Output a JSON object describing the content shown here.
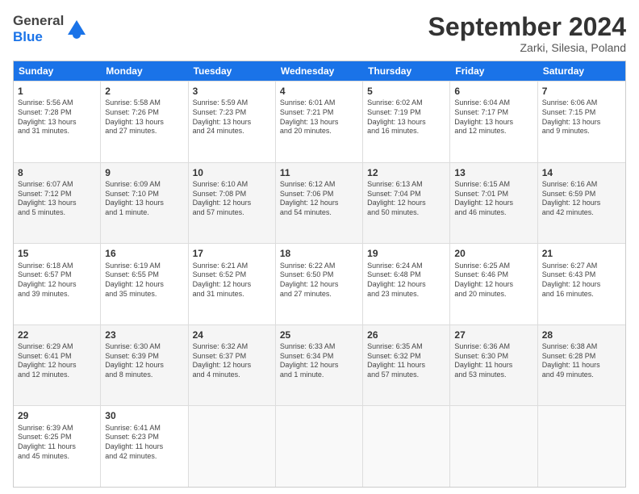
{
  "logo": {
    "line1": "General",
    "line2": "Blue"
  },
  "title": "September 2024",
  "location": "Zarki, Silesia, Poland",
  "weekdays": [
    "Sunday",
    "Monday",
    "Tuesday",
    "Wednesday",
    "Thursday",
    "Friday",
    "Saturday"
  ],
  "rows": [
    [
      {
        "day": "1",
        "info": "Sunrise: 5:56 AM\nSunset: 7:28 PM\nDaylight: 13 hours\nand 31 minutes."
      },
      {
        "day": "2",
        "info": "Sunrise: 5:58 AM\nSunset: 7:26 PM\nDaylight: 13 hours\nand 27 minutes."
      },
      {
        "day": "3",
        "info": "Sunrise: 5:59 AM\nSunset: 7:23 PM\nDaylight: 13 hours\nand 24 minutes."
      },
      {
        "day": "4",
        "info": "Sunrise: 6:01 AM\nSunset: 7:21 PM\nDaylight: 13 hours\nand 20 minutes."
      },
      {
        "day": "5",
        "info": "Sunrise: 6:02 AM\nSunset: 7:19 PM\nDaylight: 13 hours\nand 16 minutes."
      },
      {
        "day": "6",
        "info": "Sunrise: 6:04 AM\nSunset: 7:17 PM\nDaylight: 13 hours\nand 12 minutes."
      },
      {
        "day": "7",
        "info": "Sunrise: 6:06 AM\nSunset: 7:15 PM\nDaylight: 13 hours\nand 9 minutes."
      }
    ],
    [
      {
        "day": "8",
        "info": "Sunrise: 6:07 AM\nSunset: 7:12 PM\nDaylight: 13 hours\nand 5 minutes."
      },
      {
        "day": "9",
        "info": "Sunrise: 6:09 AM\nSunset: 7:10 PM\nDaylight: 13 hours\nand 1 minute."
      },
      {
        "day": "10",
        "info": "Sunrise: 6:10 AM\nSunset: 7:08 PM\nDaylight: 12 hours\nand 57 minutes."
      },
      {
        "day": "11",
        "info": "Sunrise: 6:12 AM\nSunset: 7:06 PM\nDaylight: 12 hours\nand 54 minutes."
      },
      {
        "day": "12",
        "info": "Sunrise: 6:13 AM\nSunset: 7:04 PM\nDaylight: 12 hours\nand 50 minutes."
      },
      {
        "day": "13",
        "info": "Sunrise: 6:15 AM\nSunset: 7:01 PM\nDaylight: 12 hours\nand 46 minutes."
      },
      {
        "day": "14",
        "info": "Sunrise: 6:16 AM\nSunset: 6:59 PM\nDaylight: 12 hours\nand 42 minutes."
      }
    ],
    [
      {
        "day": "15",
        "info": "Sunrise: 6:18 AM\nSunset: 6:57 PM\nDaylight: 12 hours\nand 39 minutes."
      },
      {
        "day": "16",
        "info": "Sunrise: 6:19 AM\nSunset: 6:55 PM\nDaylight: 12 hours\nand 35 minutes."
      },
      {
        "day": "17",
        "info": "Sunrise: 6:21 AM\nSunset: 6:52 PM\nDaylight: 12 hours\nand 31 minutes."
      },
      {
        "day": "18",
        "info": "Sunrise: 6:22 AM\nSunset: 6:50 PM\nDaylight: 12 hours\nand 27 minutes."
      },
      {
        "day": "19",
        "info": "Sunrise: 6:24 AM\nSunset: 6:48 PM\nDaylight: 12 hours\nand 23 minutes."
      },
      {
        "day": "20",
        "info": "Sunrise: 6:25 AM\nSunset: 6:46 PM\nDaylight: 12 hours\nand 20 minutes."
      },
      {
        "day": "21",
        "info": "Sunrise: 6:27 AM\nSunset: 6:43 PM\nDaylight: 12 hours\nand 16 minutes."
      }
    ],
    [
      {
        "day": "22",
        "info": "Sunrise: 6:29 AM\nSunset: 6:41 PM\nDaylight: 12 hours\nand 12 minutes."
      },
      {
        "day": "23",
        "info": "Sunrise: 6:30 AM\nSunset: 6:39 PM\nDaylight: 12 hours\nand 8 minutes."
      },
      {
        "day": "24",
        "info": "Sunrise: 6:32 AM\nSunset: 6:37 PM\nDaylight: 12 hours\nand 4 minutes."
      },
      {
        "day": "25",
        "info": "Sunrise: 6:33 AM\nSunset: 6:34 PM\nDaylight: 12 hours\nand 1 minute."
      },
      {
        "day": "26",
        "info": "Sunrise: 6:35 AM\nSunset: 6:32 PM\nDaylight: 11 hours\nand 57 minutes."
      },
      {
        "day": "27",
        "info": "Sunrise: 6:36 AM\nSunset: 6:30 PM\nDaylight: 11 hours\nand 53 minutes."
      },
      {
        "day": "28",
        "info": "Sunrise: 6:38 AM\nSunset: 6:28 PM\nDaylight: 11 hours\nand 49 minutes."
      }
    ],
    [
      {
        "day": "29",
        "info": "Sunrise: 6:39 AM\nSunset: 6:25 PM\nDaylight: 11 hours\nand 45 minutes."
      },
      {
        "day": "30",
        "info": "Sunrise: 6:41 AM\nSunset: 6:23 PM\nDaylight: 11 hours\nand 42 minutes."
      },
      {
        "day": "",
        "info": ""
      },
      {
        "day": "",
        "info": ""
      },
      {
        "day": "",
        "info": ""
      },
      {
        "day": "",
        "info": ""
      },
      {
        "day": "",
        "info": ""
      }
    ]
  ]
}
